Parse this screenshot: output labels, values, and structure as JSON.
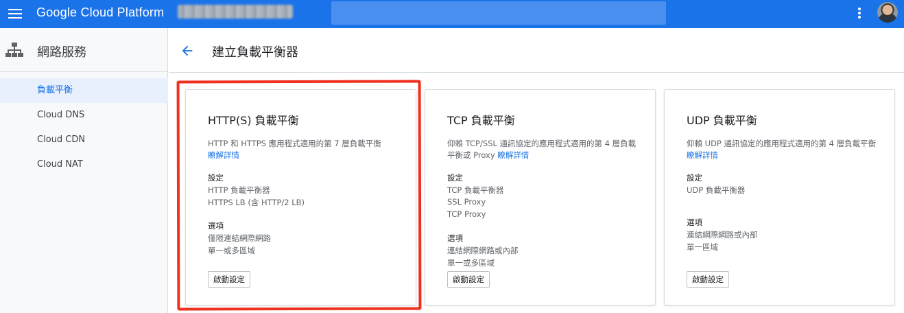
{
  "topbar": {
    "brand": "Google Cloud Platform",
    "accent_color": "#1a73e8",
    "icons": [
      "hamburger-menu-icon",
      "more-vert-icon",
      "avatar"
    ]
  },
  "sidebar": {
    "title": "網路服務",
    "icon": "network-services-icon",
    "items": [
      {
        "label": "負載平衡",
        "active": true
      },
      {
        "label": "Cloud DNS",
        "active": false
      },
      {
        "label": "Cloud CDN",
        "active": false
      },
      {
        "label": "Cloud NAT",
        "active": false
      }
    ]
  },
  "header": {
    "title": "建立負載平衡器",
    "back_icon": "arrow-back-icon"
  },
  "cards": [
    {
      "title": "HTTP(S) 負載平衡",
      "description": "HTTP 和 HTTPS 應用程式適用的第 7 層負載平衡",
      "learn_more": "瞭解詳情",
      "config_label": "設定",
      "config_items": [
        "HTTP 負載平衡器",
        "HTTPS LB (含 HTTP/2 LB)"
      ],
      "options_label": "選項",
      "options_items": [
        "僅限連結網際網路",
        "單一或多區域"
      ],
      "button": "啟動設定"
    },
    {
      "title": "TCP 負載平衡",
      "description": "仰賴 TCP/SSL 通訊協定的應用程式適用的第 4 層負載平衡或 Proxy",
      "learn_more": "瞭解詳情",
      "config_label": "設定",
      "config_items": [
        "TCP 負載平衡器",
        "SSL Proxy",
        "TCP Proxy"
      ],
      "options_label": "選項",
      "options_items": [
        "連結網際網路或內部",
        "單一或多區域"
      ],
      "button": "啟動設定"
    },
    {
      "title": "UDP 負載平衡",
      "description": "仰賴 UDP 通訊協定的應用程式適用的第 4 層負載平衡",
      "learn_more": "瞭解詳情",
      "config_label": "設定",
      "config_items": [
        "UDP 負載平衡器"
      ],
      "options_label": "選項",
      "options_items": [
        "連結網際網路或內部",
        "單一區域"
      ],
      "button": "啟動設定"
    }
  ],
  "annotation": {
    "highlight_color": "#f0301e"
  }
}
